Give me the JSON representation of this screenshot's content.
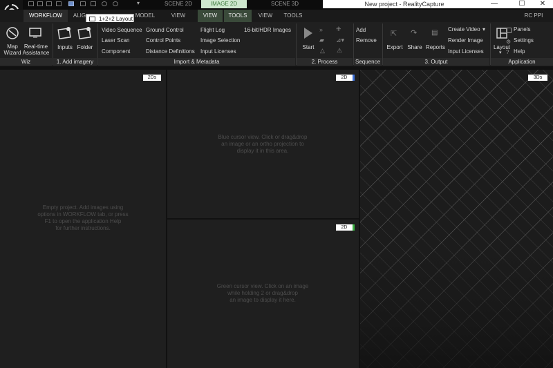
{
  "window": {
    "title": "New project - RealityCapture",
    "minimize": "—",
    "maximize": "☐",
    "close": "✕"
  },
  "context_tabs": {
    "scene2d": "SCENE 2D",
    "image2d": "IMAGE 2D",
    "scene3d": "SCENE 3D"
  },
  "tabs": {
    "workflow": "WORKFLOW",
    "alignment": "ALIG",
    "model": "MODEL",
    "view1": "VIEW",
    "view2": "VIEW",
    "tools1": "TOOLS",
    "view3": "VIEW",
    "tools2": "TOOLS",
    "rcppi": "RC PPI"
  },
  "tooltip": "1+2+2 Layout",
  "ribbon": {
    "wiz": {
      "map_wizard": "Map\nWizard",
      "realtime": "Real-time\nAssistance",
      "group": "Wiz"
    },
    "add_imagery": {
      "inputs": "Inputs",
      "folder": "Folder",
      "group": "1. Add imagery"
    },
    "import": {
      "col1": [
        "Video Sequence",
        "Laser Scan",
        "Component"
      ],
      "col2": [
        "Ground Control",
        "Control Points",
        "Distance Definitions"
      ],
      "col3": [
        "Flight Log",
        "Image Selection",
        "Input Licenses"
      ],
      "hdr": "16-bit/HDR Images",
      "group": "Import & Metadata"
    },
    "process": {
      "start": "Start",
      "group": "2. Process"
    },
    "sequence": {
      "add": "Add",
      "remove": "Remove",
      "group": "Sequence"
    },
    "output": {
      "export": "Export",
      "share": "Share",
      "reports": "Reports",
      "create_video": "Create Video",
      "render_image": "Render Image",
      "input_licenses": "Input Licenses",
      "group": "3. Output"
    },
    "application": {
      "layout": "Layout",
      "panels": "Panels",
      "settings": "Settings",
      "help": "Help",
      "group": "Application"
    }
  },
  "panels": {
    "left": {
      "badge": "2Ds",
      "text": "Empty project. Add images using\noptions in WORKFLOW tab, or press\nF1 to open the application Help\nfor further instructions."
    },
    "top_mid": {
      "badge": "2D",
      "text": "Blue cursor view. Click or drag&drop\nan image or an ortho projection to\ndisplay it in this area."
    },
    "bot_mid": {
      "badge": "2D",
      "text": "Green cursor view. Click on an image\nwhile holding 2 or drag&drop\nan image to display it here."
    },
    "right": {
      "badge": "3Ds"
    }
  },
  "colors": {
    "accent_blue": "#3c6fd6",
    "accent_green": "#3cb043",
    "panel_bg": "#1f1f1f"
  }
}
